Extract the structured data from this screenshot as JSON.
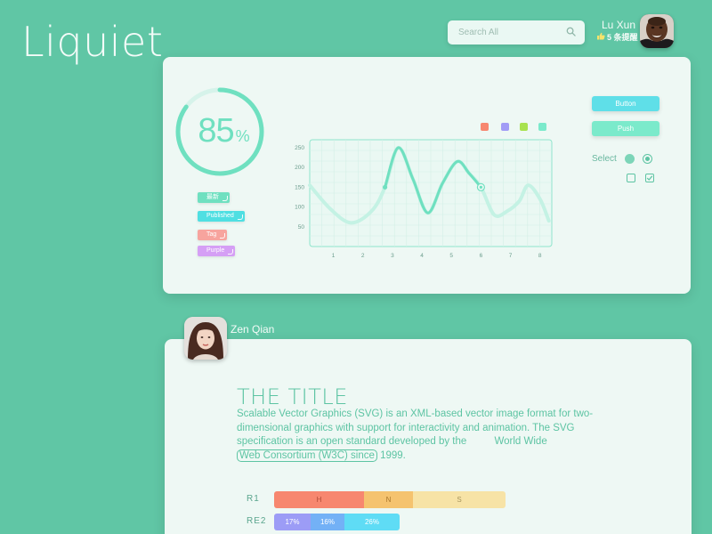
{
  "app": {
    "logo": "Liquiet"
  },
  "search": {
    "placeholder": "Search All",
    "icon": "search-icon"
  },
  "user": {
    "name": "Lu Xun",
    "notification": "5 条提醒",
    "notification_icon": "thumbs-up-icon"
  },
  "gauge": {
    "value": "85",
    "unit": "%",
    "fraction": 0.85,
    "color": "#6fe0c0"
  },
  "tags": [
    {
      "label": "最新",
      "color": "#6fe0c0"
    },
    {
      "label": "Published",
      "color": "#4fdfe2"
    },
    {
      "label": "Tag",
      "color": "#f7a49e"
    },
    {
      "label": "Purple",
      "color": "#d59ff5"
    }
  ],
  "legend": {
    "colors": [
      "#f7876f",
      "#a19cf6",
      "#a8e24f",
      "#7beacb"
    ]
  },
  "chart_data": {
    "type": "line",
    "x": [
      1,
      2,
      3,
      4,
      5,
      6,
      7,
      8
    ],
    "xlim": [
      0.2,
      8.4
    ],
    "ylim": [
      0,
      270
    ],
    "yticks": [
      50,
      100,
      150,
      200,
      250
    ],
    "xticks": [
      1,
      2,
      3,
      4,
      5,
      6,
      7,
      8
    ],
    "series": [
      {
        "points": [
          [
            0.2,
            155
          ],
          [
            0.9,
            95
          ],
          [
            1.6,
            60
          ],
          [
            2.3,
            90
          ],
          [
            2.75,
            150
          ],
          [
            3.2,
            250
          ],
          [
            3.7,
            170
          ],
          [
            4.2,
            85
          ],
          [
            4.7,
            160
          ],
          [
            5.2,
            215
          ],
          [
            5.6,
            185
          ],
          [
            6.0,
            150
          ],
          [
            6.45,
            80
          ],
          [
            6.9,
            90
          ],
          [
            7.3,
            115
          ],
          [
            7.6,
            155
          ],
          [
            8.0,
            120
          ],
          [
            8.3,
            65
          ]
        ],
        "highlight": {
          "x_from": 2.75,
          "x_to": 6.0
        },
        "markers": [
          [
            2.75,
            150
          ],
          [
            6.0,
            150
          ]
        ]
      }
    ],
    "grid": true,
    "colors": {
      "line": "#6fe0c0",
      "line_faded": "#c4f2e4",
      "axis_text": "#6a9c8c"
    }
  },
  "buttons": [
    {
      "label": "Button",
      "color": "#5fdfe8"
    },
    {
      "label": "Push",
      "color": "#7beacb"
    }
  ],
  "select": {
    "label": "Select"
  },
  "author": {
    "name": "Zen Qian"
  },
  "article": {
    "title": "THE TITLE",
    "text_before": "Scalable Vector Graphics (SVG) is an XML-based vector image format for two-dimensional graphics with support for interactivity and animation. The SVG specification is an open standard developed by the ",
    "text_mid": "World Wide",
    "text_link": "Web Consortium   (W3C) since",
    "text_after": " 1999."
  },
  "bars": {
    "r1": {
      "label": "R1",
      "segments": [
        {
          "label": "H",
          "fraction": 0.39,
          "color": "#f7876f",
          "text_color": "#b04b37"
        },
        {
          "label": "N",
          "fraction": 0.21,
          "color": "#f5c36f",
          "text_color": "#a9772a"
        },
        {
          "label": "S",
          "fraction": 0.4,
          "color": "#f7e3a6",
          "text_color": "#a7955d"
        }
      ]
    },
    "r2": {
      "label": "RE2",
      "segments": [
        {
          "label": "17%",
          "fraction": 0.17,
          "color": "#9c9cf6",
          "text_color": "#ffffff"
        },
        {
          "label": "16%",
          "fraction": 0.16,
          "color": "#73b1f6",
          "text_color": "#ffffff"
        },
        {
          "label": "26%",
          "fraction": 0.26,
          "color": "#5fdcf5",
          "text_color": "#ffffff"
        }
      ]
    }
  }
}
